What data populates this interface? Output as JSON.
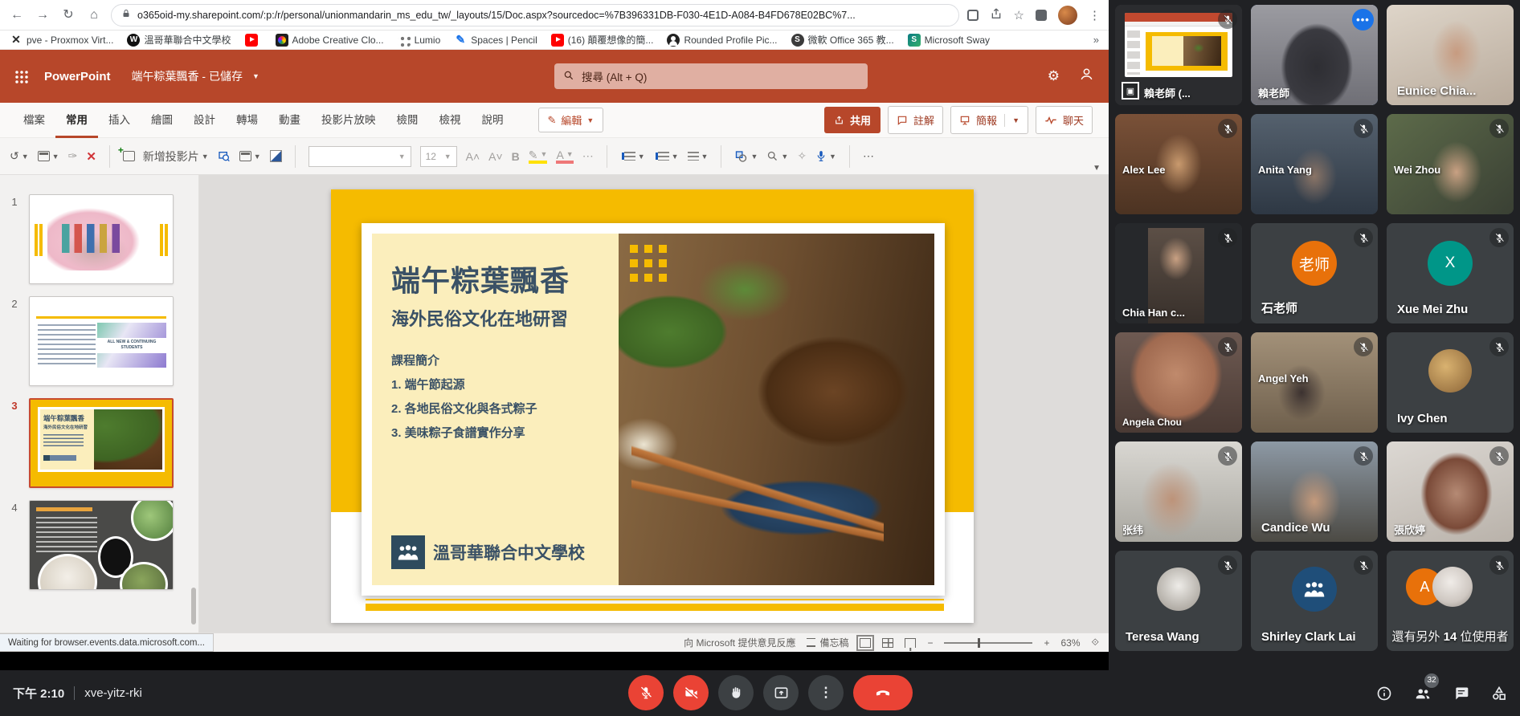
{
  "browser": {
    "url": "o365oid-my.sharepoint.com/:p:/r/personal/unionmandarin_ms_edu_tw/_layouts/15/Doc.aspx?sourcedoc=%7B396331DB-F030-4E1D-A084-B4FD678E02BC%7...",
    "bookmarks": [
      {
        "icon": "proxmox-icon",
        "label": "pve - Proxmox Virt..."
      },
      {
        "icon": "w-badge-icon",
        "label": "溫哥華聯合中文學校"
      },
      {
        "icon": "youtube-icon",
        "label": ""
      },
      {
        "icon": "adobe-cc-icon",
        "label": "Adobe Creative Clo..."
      },
      {
        "icon": "lumio-icon",
        "label": "Lumio"
      },
      {
        "icon": "pencil-icon",
        "label": "Spaces | Pencil"
      },
      {
        "icon": "youtube-icon",
        "label": "(16) 顛覆想像的簡..."
      },
      {
        "icon": "profile-icon",
        "label": "Rounded Profile Pic..."
      },
      {
        "icon": "office365-icon",
        "label": "微軟 Office 365 教..."
      },
      {
        "icon": "sway-icon",
        "label": "Microsoft Sway"
      }
    ],
    "bookmarks_overflow": "»"
  },
  "ppt": {
    "app_name": "PowerPoint",
    "doc_title": "端午粽葉飄香 - 已儲存",
    "search_placeholder": "搜尋 (Alt + Q)",
    "tabs": [
      "檔案",
      "常用",
      "插入",
      "繪圖",
      "設計",
      "轉場",
      "動畫",
      "投影片放映",
      "檢閱",
      "檢視",
      "說明"
    ],
    "edit_button": "編輯",
    "share_button": "共用",
    "comments_button": "註解",
    "present_button": "簡報",
    "chat_button": "聊天",
    "new_slide_button": "新增投影片",
    "font_size": "12",
    "slide_numbers": [
      "1",
      "2",
      "3",
      "4"
    ],
    "thumb2_caption": "ALL NEW & CONTINUING STUDENTS",
    "slide": {
      "title": "端午粽葉飄香",
      "subtitle": "海外民俗文化在地研習",
      "section_heading": "課程簡介",
      "items": [
        "1. 端午節起源",
        "2. 各地民俗文化與各式粽子",
        "3. 美味粽子食譜實作分享"
      ],
      "school_name": "溫哥華聯合中文學校"
    },
    "status_bar": {
      "loading_text": "Waiting for browser.events.data.microsoft.com...",
      "feedback": "向 Microsoft 提供意見反應",
      "notes": "備忘稿",
      "zoom_level": "63%"
    }
  },
  "meet": {
    "time": "下午 2:10",
    "meeting_code": "xve-yitz-rki",
    "people_count": "32",
    "tiles": [
      {
        "name": "賴老師 (..."
      },
      {
        "name": "賴老師"
      },
      {
        "name": "Eunice Chia..."
      },
      {
        "name": "Alex Lee"
      },
      {
        "name": "Anita Yang"
      },
      {
        "name": "Wei Zhou"
      },
      {
        "name": "Chia Han c..."
      },
      {
        "name": "石老师",
        "avatar_text": "老师"
      },
      {
        "name": "Xue Mei Zhu",
        "avatar_text": "X"
      },
      {
        "name": "Angela Chou"
      },
      {
        "name": "Angel Yeh"
      },
      {
        "name": "Ivy Chen"
      },
      {
        "name": "张纬"
      },
      {
        "name": "Candice Wu"
      },
      {
        "name": "張欣婷"
      },
      {
        "name": "Teresa Wang"
      },
      {
        "name": "Shirley Clark Lai"
      },
      {
        "name": "還有另外 14 位使用者",
        "prefix": "還有另外",
        "count": "14",
        "suffix": "位使用者"
      }
    ]
  },
  "colors": {
    "ppt_brand": "#B7472A",
    "meet_bg": "#202124",
    "tile_bg": "#3C4043",
    "active_speaker_border": "#8AB4F8",
    "menu_badge_blue": "#1A73E8",
    "danger_red": "#EA4335",
    "slide_yellow": "#F5BB00",
    "slide_cream": "#FBEEBC",
    "slide_text": "#3A5166",
    "avatar_orange": "#E8710A",
    "avatar_teal": "#009688"
  }
}
